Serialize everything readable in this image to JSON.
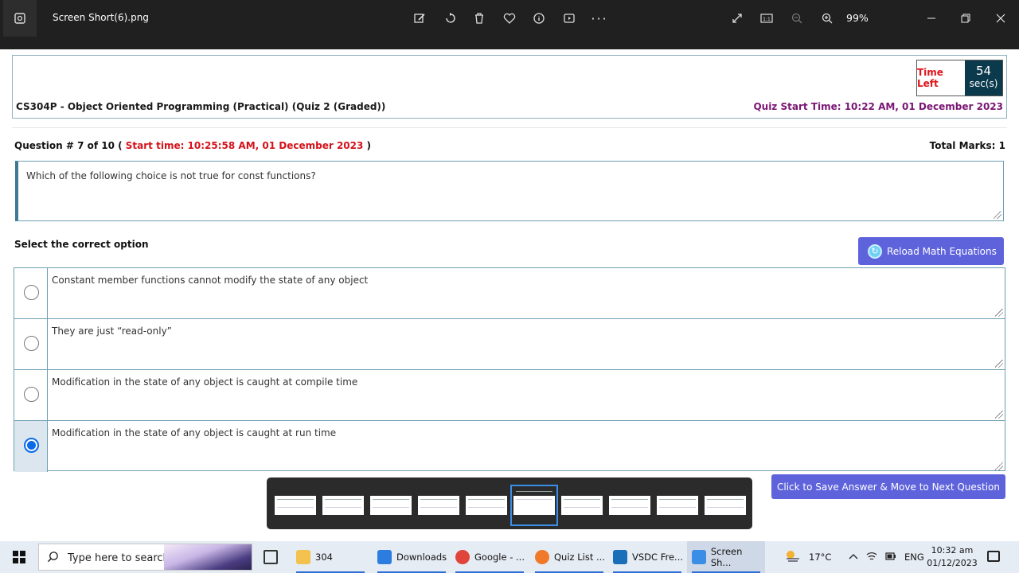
{
  "viewer": {
    "filename": "Screen Short(6).png",
    "zoom": "99%"
  },
  "quiz": {
    "course_title": "CS304P - Object Oriented Programming (Practical) (Quiz 2 (Graded))",
    "quiz_start_time": "Quiz Start Time: 10:22 AM, 01 December 2023",
    "timer_label": "Time Left",
    "timer_value": "54",
    "timer_unit": "sec(s)",
    "question_prefix": "Question # 7 of 10 ( ",
    "question_start": "Start time: 10:25:58 AM, 01 December 2023",
    "question_suffix": " )",
    "total_marks": "Total Marks: 1",
    "question_text": "Which of the following choice is not true for const functions?",
    "select_label": "Select the correct option",
    "reload_label": "Reload Math Equations",
    "options": [
      {
        "text": "Constant member functions cannot modify the state of any object",
        "selected": false
      },
      {
        "text": "They are just “read-only”",
        "selected": false
      },
      {
        "text": "Modification in the state of any object is caught at compile time",
        "selected": false
      },
      {
        "text": "Modification in the state of any object is caught at run time",
        "selected": true
      }
    ],
    "next_label": "Click to Save Answer & Move to Next Question"
  },
  "taskbar": {
    "search_placeholder": "Type here to search",
    "items": [
      {
        "label": "304",
        "icon": "folder-icon",
        "color": "#f2c14e"
      },
      {
        "label": "Downloads",
        "icon": "download-icon",
        "color": "#2d7de0"
      },
      {
        "label": "Google - ...",
        "icon": "chrome-icon",
        "color": "#e0443a"
      },
      {
        "label": "Quiz List ...",
        "icon": "firefox-icon",
        "color": "#f0792a"
      },
      {
        "label": "VSDC Fre...",
        "icon": "vsdc-icon",
        "color": "#1a6fb8"
      },
      {
        "label": "Screen Sh...",
        "icon": "photos-icon",
        "color": "#3a8ee6"
      }
    ],
    "temperature": "17°C",
    "language": "ENG",
    "time": "10:32 am",
    "date": "01/12/2023"
  }
}
